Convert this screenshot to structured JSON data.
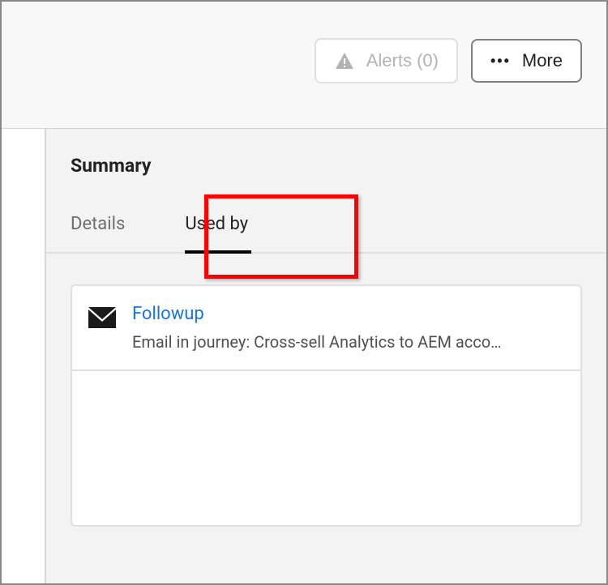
{
  "toolbar": {
    "alerts_label": "Alerts (0)",
    "more_label": "More"
  },
  "panel": {
    "title": "Summary"
  },
  "tabs": {
    "details_label": "Details",
    "usedby_label": "Used by"
  },
  "usedby": {
    "items": [
      {
        "title": "Followup",
        "subtitle": "Email in journey: Cross-sell Analytics to AEM acco…"
      }
    ]
  }
}
